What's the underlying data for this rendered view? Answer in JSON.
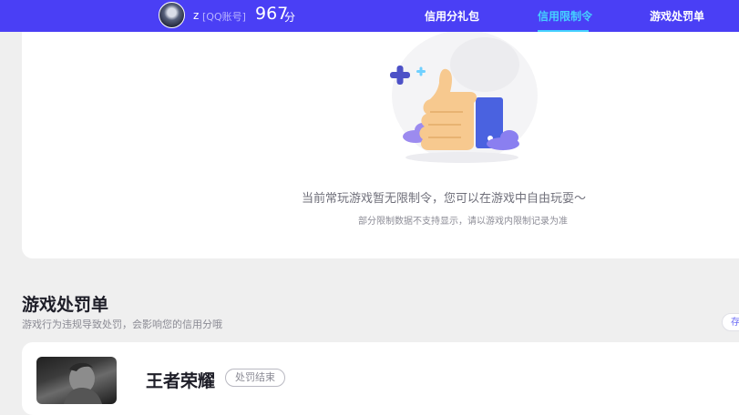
{
  "header": {
    "user_name": "z",
    "account_type": "[QQ账号]",
    "score": "967",
    "score_unit": "分",
    "nav": [
      {
        "label": "信用分礼包",
        "active": false
      },
      {
        "label": "信用限制令",
        "active": true
      },
      {
        "label": "游戏处罚单",
        "active": false
      }
    ]
  },
  "restriction_card": {
    "illustration_icon": "thumbs-up-icon",
    "empty_message": "当前常玩游戏暂无限制令，您可以在游戏中自由玩耍～",
    "note": "部分限制数据不支持显示，请以游戏内限制记录为准"
  },
  "penalty_section": {
    "title": "游戏处罚单",
    "subtitle": "游戏行为违规导致处罚，会影响您的信用分哦",
    "edge_pill": "存",
    "records": [
      {
        "game": "王者荣耀",
        "status": "处罚结束"
      }
    ]
  },
  "colors": {
    "header_bg": "#4a3ff5",
    "nav_active": "#45d1ff",
    "page_bg": "#efefef"
  }
}
